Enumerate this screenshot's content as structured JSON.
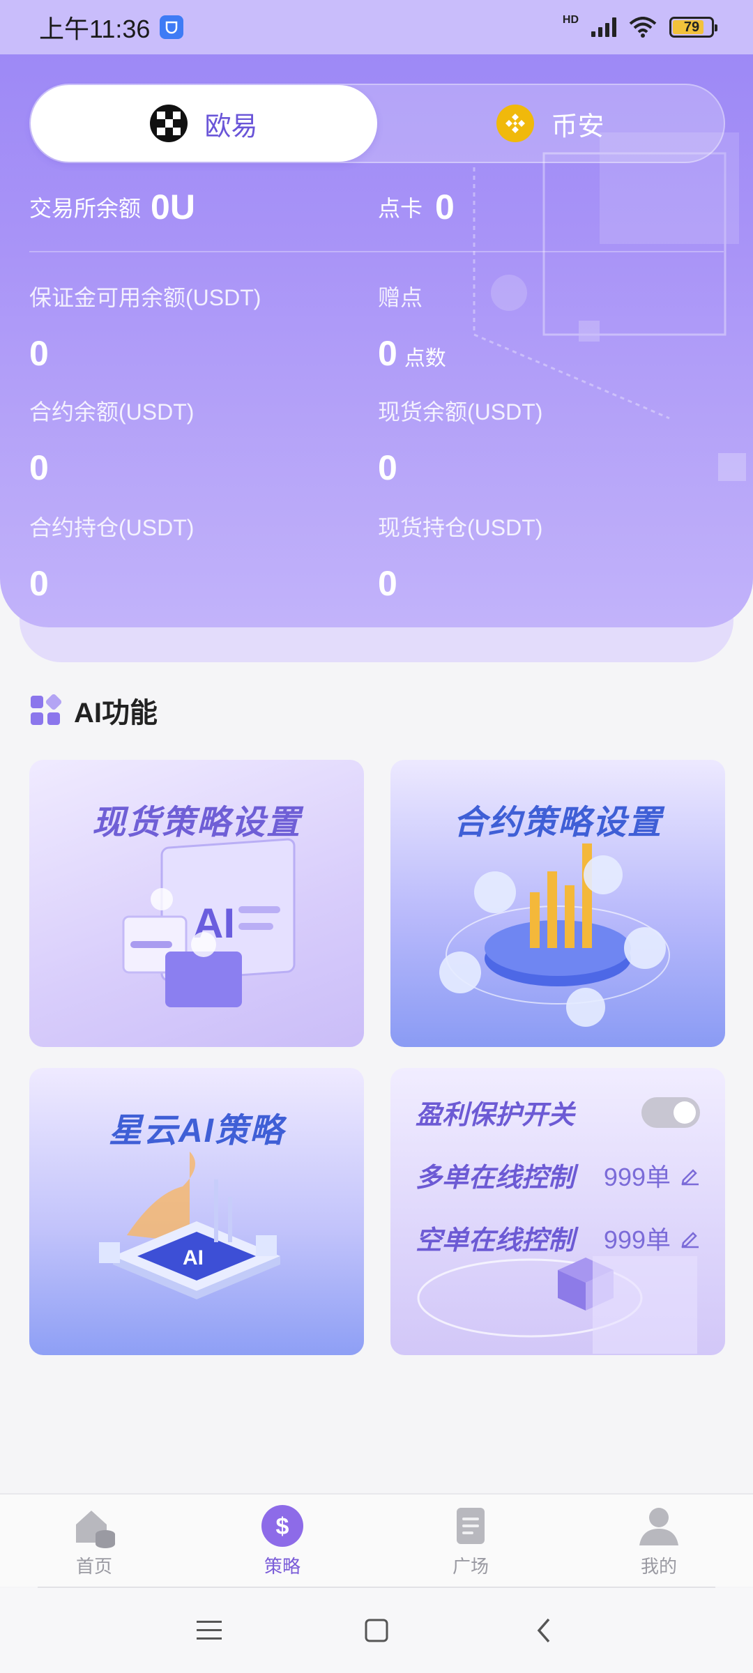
{
  "status_bar": {
    "time": "上午11:36",
    "network": "HD",
    "battery": "79",
    "battery_level": 0.79
  },
  "exchange_tabs": [
    {
      "label": "欧易",
      "icon": "okx-icon",
      "active": true
    },
    {
      "label": "币安",
      "icon": "binance-icon",
      "active": false
    }
  ],
  "balances": {
    "exchange_balance_label": "交易所余额",
    "exchange_balance_value": "0U",
    "point_card_label": "点卡",
    "point_card_value": "0",
    "margin_available_label": "保证金可用余额(USDT)",
    "margin_available_value": "0",
    "bonus_points_label": "赠点",
    "bonus_points_value": "0",
    "bonus_points_unit": "点数",
    "contract_balance_label": "合约余额(USDT)",
    "contract_balance_value": "0",
    "spot_balance_label": "现货余额(USDT)",
    "spot_balance_value": "0",
    "contract_position_label": "合约持仓(USDT)",
    "contract_position_value": "0",
    "spot_position_label": "现货持仓(USDT)",
    "spot_position_value": "0"
  },
  "ai_section": {
    "title": "AI功能",
    "cards": {
      "spot_strategy": "现货策略设置",
      "contract_strategy": "合约策略设置",
      "nebula_ai": "星云AI策略"
    },
    "profit_panel": {
      "protection_label": "盈利保护开关",
      "protection_on": false,
      "long_label": "多单在线控制",
      "long_value": "999单",
      "short_label": "空单在线控制",
      "short_value": "999单"
    }
  },
  "bottom_nav": [
    {
      "label": "首页",
      "icon": "home-icon",
      "active": false
    },
    {
      "label": "策略",
      "icon": "dollar-icon",
      "active": true
    },
    {
      "label": "广场",
      "icon": "document-icon",
      "active": false
    },
    {
      "label": "我的",
      "icon": "person-icon",
      "active": false
    }
  ],
  "colors": {
    "primary": "#9a86f6",
    "accent": "#7a5cd8",
    "nav_inactive": "#9a9aa2"
  }
}
